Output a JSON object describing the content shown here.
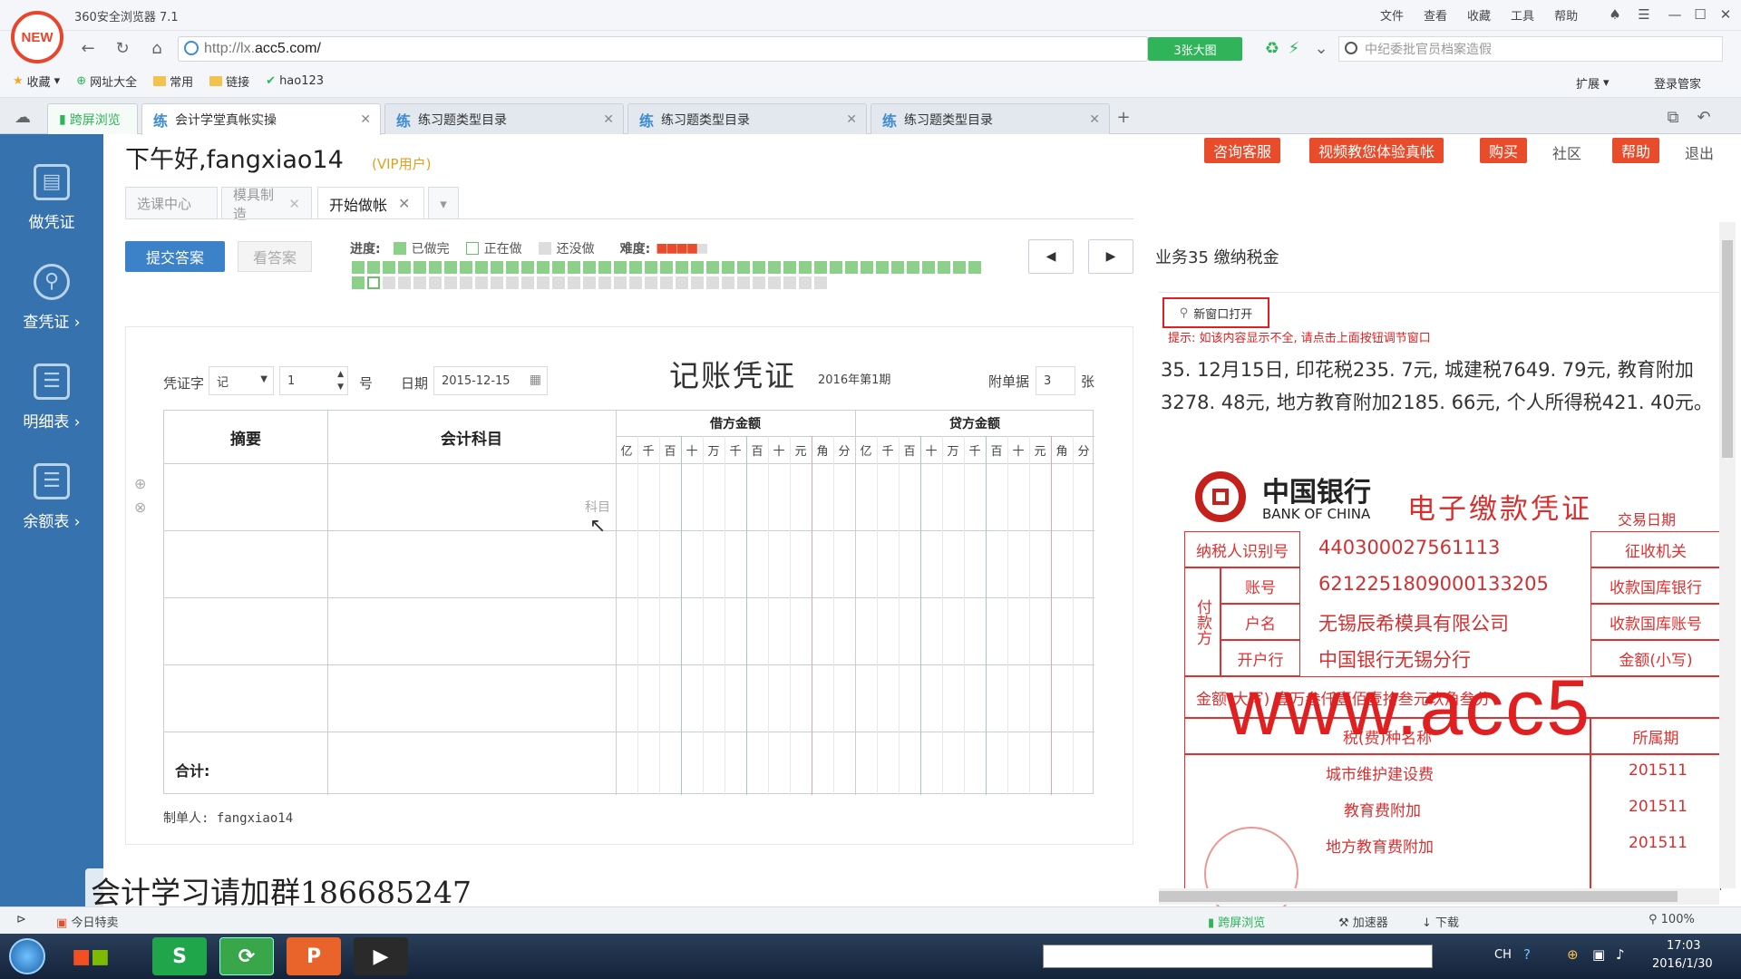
{
  "browser": {
    "logo_text": "NEW",
    "title": "360安全浏览器 7.1",
    "menus": [
      "文件",
      "查看",
      "收藏",
      "工具",
      "帮助"
    ],
    "url_prefix": "http://lx.",
    "url_domain": "acc5.com/",
    "zoom_button": "3张大图",
    "search_placeholder": "中纪委批官员档案造假",
    "extension_label": "扩展",
    "login_label": "登录管家"
  },
  "bookmarks": [
    "收藏",
    "网址大全",
    "常用",
    "链接",
    "hao123"
  ],
  "tabs": [
    {
      "label": "跨屏浏览"
    },
    {
      "label": "会计学堂真帐实操",
      "mark": "练"
    },
    {
      "label": "练习题类型目录",
      "mark": "练"
    },
    {
      "label": "练习题类型目录",
      "mark": "练"
    },
    {
      "label": "练习题类型目录",
      "mark": "练"
    }
  ],
  "sidebar": [
    "做凭证",
    "查凭证 ›",
    "明细表 ›",
    "余额表 ›"
  ],
  "header": {
    "greeting": "下午好,fangxiao14",
    "vip": "(VIP用户)",
    "buttons": [
      "咨询客服",
      "视频教您体验真帐",
      "购买",
      "帮助"
    ],
    "links": [
      "社区",
      "退出"
    ]
  },
  "subtabs": [
    "选课中心",
    "模具制造",
    "开始做帐"
  ],
  "toolbar": {
    "submit": "提交答案",
    "answer": "看答案",
    "progress_label": "进度:",
    "legend": [
      "已做完",
      "正在做",
      "还没做"
    ],
    "difficulty_label": "难度:",
    "progress_done": 42,
    "progress_current": 43,
    "progress_total": 72
  },
  "business_title": "业务35  缴纳税金",
  "voucher": {
    "word_label": "凭证字",
    "word_value": "记",
    "number_value": "1",
    "number_suffix": "号",
    "date_label": "日期",
    "date_value": "2015-12-15",
    "title": "记账凭证",
    "period": "2016年第1期",
    "attach_label": "附单据",
    "attach_value": "3",
    "attach_suffix": "张",
    "col_summary": "摘要",
    "col_account": "会计科目",
    "col_debit": "借方金额",
    "col_credit": "贷方金额",
    "digits": [
      "亿",
      "千",
      "百",
      "十",
      "万",
      "千",
      "百",
      "十",
      "元",
      "角",
      "分"
    ],
    "account_placeholder": "科目",
    "total_label": "合计:",
    "maker": "制单人: fangxiao14"
  },
  "right": {
    "new_window": "新窗口打开",
    "tip": "提示: 如该内容显示不全, 请点击上面按钮调节窗口",
    "business_text": "35. 12月15日, 印花税235. 7元, 城建税7649. 79元, 教育附加3278. 48元, 地方教育附加2185. 66元, 个人所得税421. 40元。",
    "bank_name": "中国银行",
    "bank_en": "BANK OF CHINA",
    "doc_title": "电子缴款凭证",
    "trade_date": "交易日期",
    "rows": [
      {
        "label": "纳税人识别号",
        "value": "440300027561113",
        "right": "征收机关"
      },
      {
        "label": "账号",
        "value": "6212251809000133205",
        "right": "收款国库银行"
      },
      {
        "label": "户名",
        "value": "无锡辰希模具有限公司",
        "right": "收款国库账号"
      },
      {
        "label": "开户行",
        "value": "中国银行无锡分行",
        "right": "金额(小写)"
      }
    ],
    "payer": "付款方",
    "amount_cn": "金额(大写)  壹万叁仟壹佰壹拾叁元玖角叁分",
    "tax_head": "税(费)种名称",
    "period_head": "所属期",
    "tax_rows": [
      {
        "name": "城市维护建设费",
        "period": "201511"
      },
      {
        "name": "教育费附加",
        "period": "201511"
      },
      {
        "name": "地方教育费附加",
        "period": "201511"
      }
    ]
  },
  "watermark": "www.acc5",
  "group_text": "会计学习请加群186685247",
  "statusbar": {
    "left": "今日特卖",
    "items": [
      "跨屏浏览",
      "加速器",
      "下载"
    ],
    "zoom": "100%"
  },
  "taskbar": {
    "lang": "CH",
    "time": "17:03",
    "date": "2016/1/30"
  }
}
